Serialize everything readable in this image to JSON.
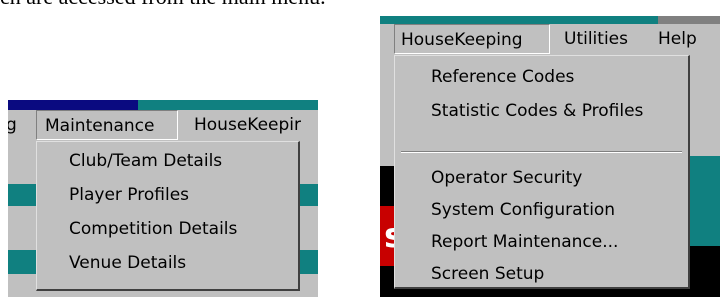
{
  "caption": "ch are accessed from the main menu.",
  "left_screen": {
    "menubar": {
      "cut_label": "g",
      "maintenance": "Maintenance",
      "housekeeping_cut": "HouseKeepir"
    },
    "maintenance_menu": [
      "Club/Team Details",
      "Player Profiles",
      "Competition Details",
      "Venue Details"
    ]
  },
  "right_screen": {
    "menubar": {
      "housekeeping": "HouseKeeping",
      "utilities": "Utilities",
      "help": "Help"
    },
    "housekeeping_menu_group1": [
      "Reference Codes",
      "Statistic Codes & Profiles"
    ],
    "housekeeping_menu_group2": [
      "Operator Security",
      "System Configuration",
      "Report Maintenance...",
      "Screen Setup"
    ],
    "background_letter": "s"
  }
}
